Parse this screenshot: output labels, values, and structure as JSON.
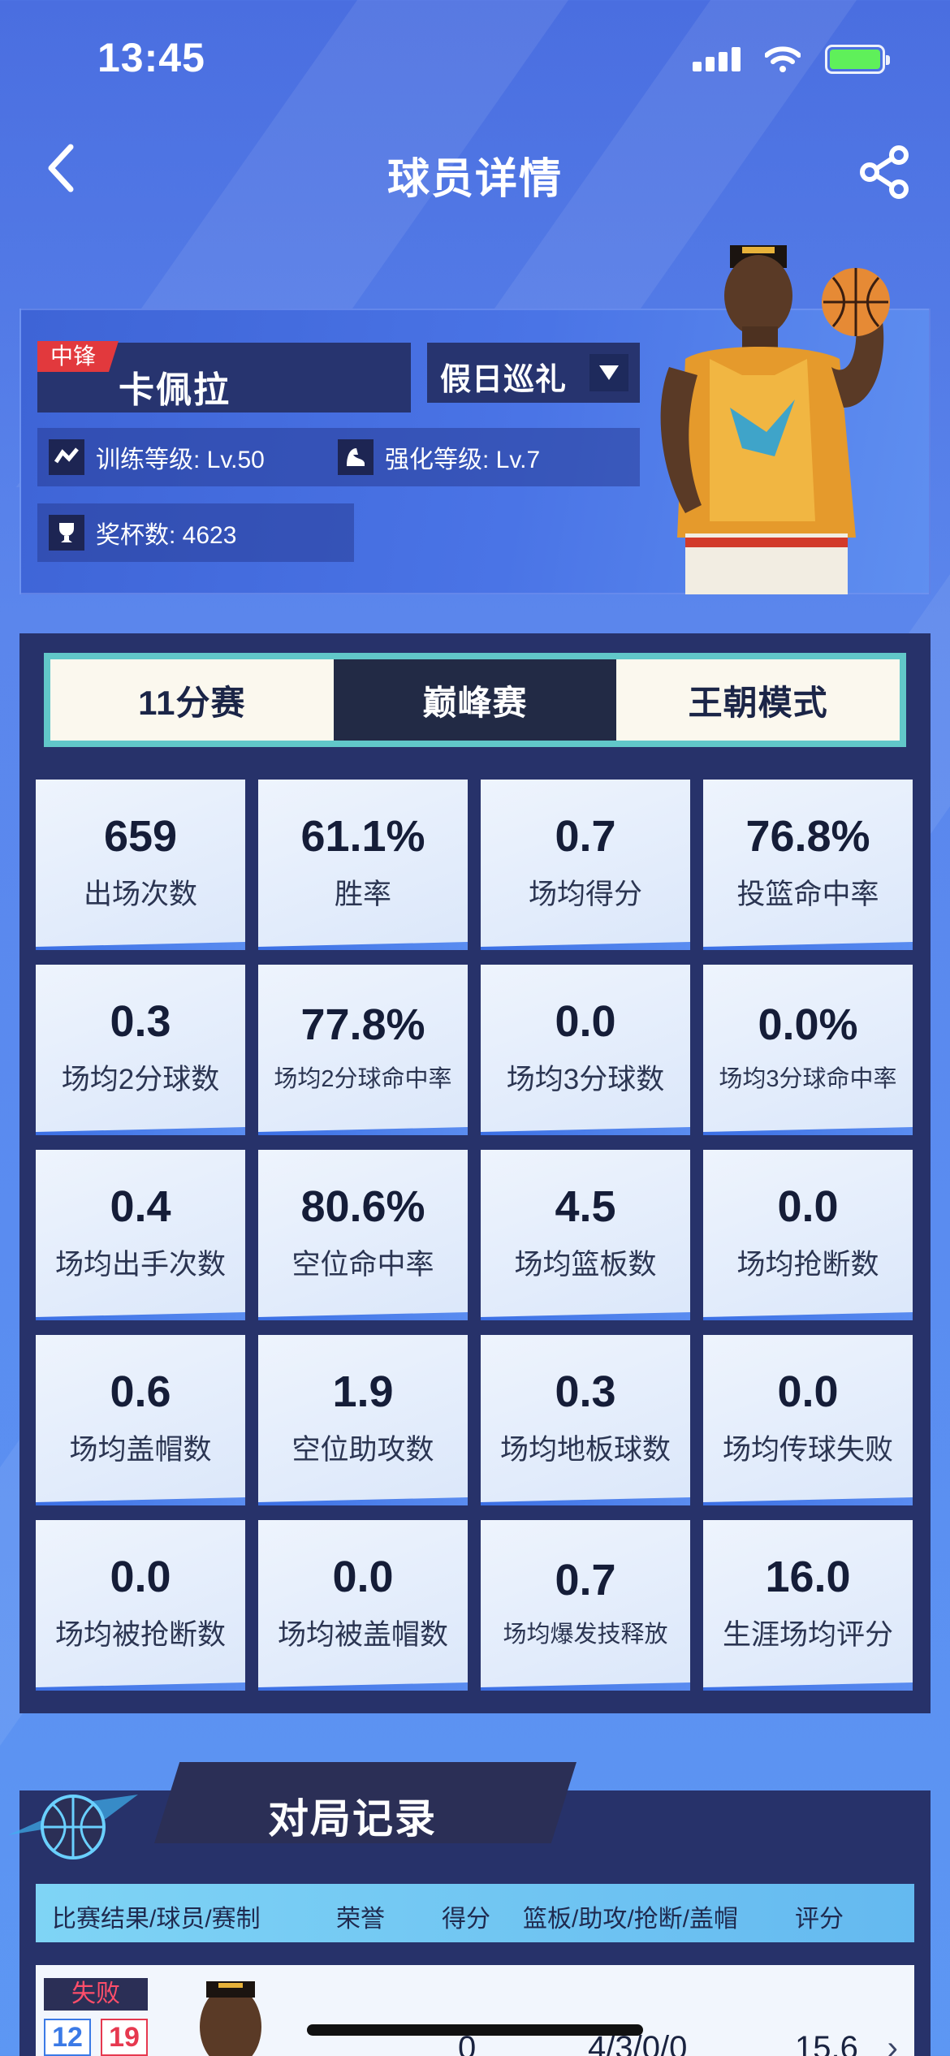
{
  "status": {
    "time": "13:45"
  },
  "nav": {
    "title": "球员详情"
  },
  "player": {
    "position": "中锋",
    "name": "卡佩拉",
    "skin": "假日巡礼",
    "training_level": "训练等级: Lv.50",
    "enhance_level": "强化等级: Lv.7",
    "trophies": "奖杯数: 4623"
  },
  "tabs": [
    {
      "label": "11分赛",
      "active": false
    },
    {
      "label": "巅峰赛",
      "active": true
    },
    {
      "label": "王朝模式",
      "active": false
    }
  ],
  "stats": [
    {
      "value": "659",
      "label": "出场次数"
    },
    {
      "value": "61.1%",
      "label": "胜率"
    },
    {
      "value": "0.7",
      "label": "场均得分"
    },
    {
      "value": "76.8%",
      "label": "投篮命中率"
    },
    {
      "value": "0.3",
      "label": "场均2分球数"
    },
    {
      "value": "77.8%",
      "label": "场均2分球命中率"
    },
    {
      "value": "0.0",
      "label": "场均3分球数"
    },
    {
      "value": "0.0%",
      "label": "场均3分球命中率"
    },
    {
      "value": "0.4",
      "label": "场均出手次数"
    },
    {
      "value": "80.6%",
      "label": "空位命中率"
    },
    {
      "value": "4.5",
      "label": "场均篮板数"
    },
    {
      "value": "0.0",
      "label": "场均抢断数"
    },
    {
      "value": "0.6",
      "label": "场均盖帽数"
    },
    {
      "value": "1.9",
      "label": "空位助攻数"
    },
    {
      "value": "0.3",
      "label": "场均地板球数"
    },
    {
      "value": "0.0",
      "label": "场均传球失败"
    },
    {
      "value": "0.0",
      "label": "场均被抢断数"
    },
    {
      "value": "0.0",
      "label": "场均被盖帽数"
    },
    {
      "value": "0.7",
      "label": "场均爆发技释放"
    },
    {
      "value": "16.0",
      "label": "生涯场均评分"
    }
  ],
  "record": {
    "title": "对局记录",
    "columns": {
      "result": "比赛结果/球员/赛制",
      "honor": "荣誉",
      "score": "得分",
      "detail": "篮板/助攻/抢断/盖帽",
      "rating": "评分"
    },
    "rows": [
      {
        "result": "失败",
        "team_score": "12",
        "opp_score": "19",
        "points": "0",
        "detail": "4/3/0/0",
        "rating": "15.6"
      }
    ]
  },
  "colors": {
    "accent": "#27326a",
    "tab_active": "#222a45",
    "lose": "#ff4e6a",
    "pos_tag": "#e2393d"
  }
}
